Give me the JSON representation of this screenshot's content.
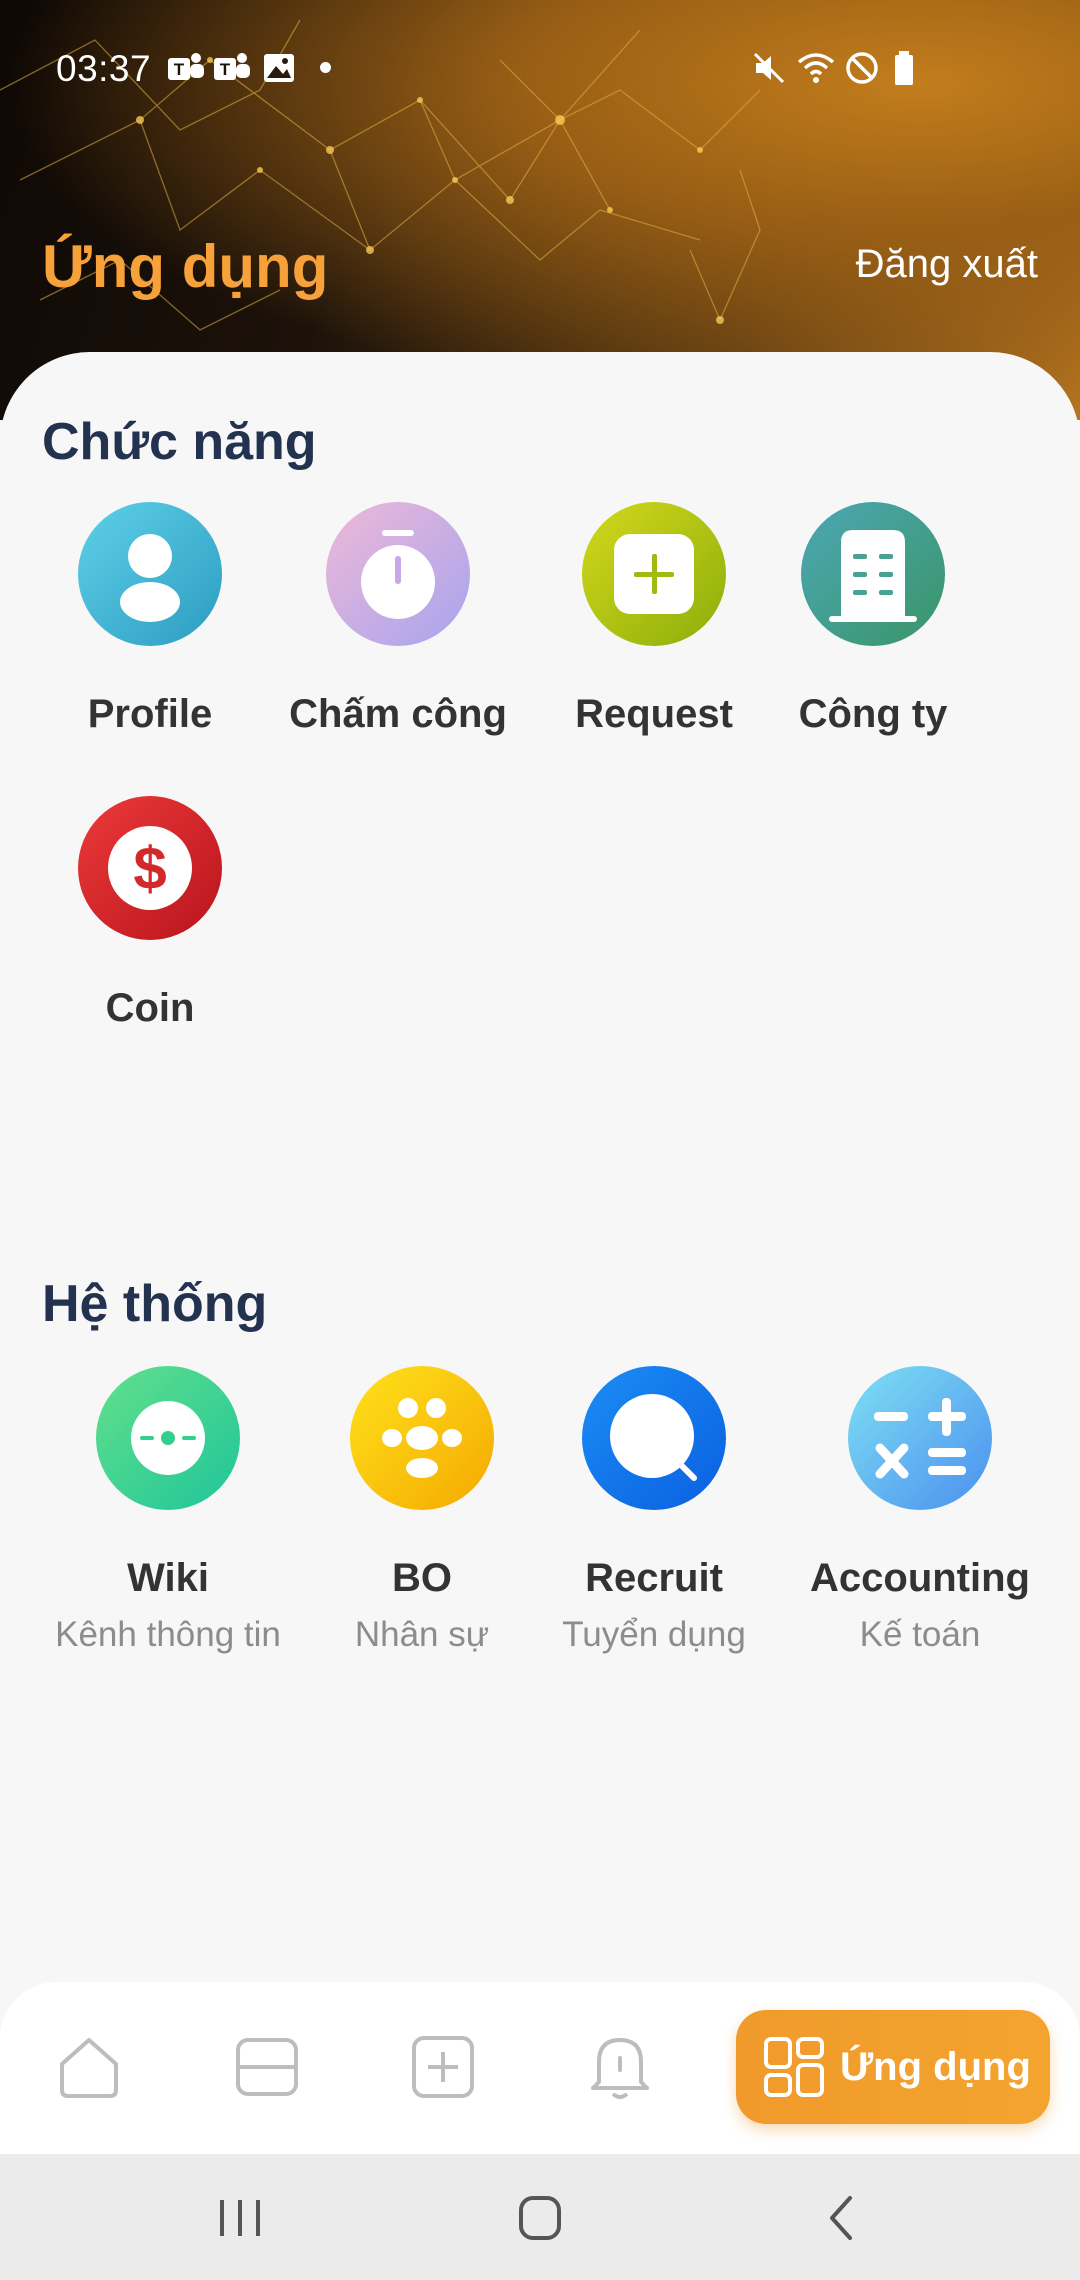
{
  "status_bar": {
    "time": "03:37",
    "left_icons": [
      "teams-icon",
      "teams-icon",
      "image-icon"
    ],
    "right_icons": [
      "mute-icon",
      "wifi-icon",
      "do-not-disturb-icon",
      "battery-icon"
    ]
  },
  "header": {
    "title": "Ứng dụng",
    "logout_label": "Đăng xuất"
  },
  "sections": {
    "features": {
      "title": "Chức năng",
      "items": [
        {
          "label": "Profile",
          "icon": "person-icon",
          "color": "#3fb3d6"
        },
        {
          "label": "Chấm công",
          "icon": "stopwatch-icon",
          "color": "#c9a6e8"
        },
        {
          "label": "Request",
          "icon": "plus-square-icon",
          "color": "#a8bd12"
        },
        {
          "label": "Công ty",
          "icon": "building-icon",
          "color": "#3f9f8c"
        },
        {
          "label": "Coin",
          "icon": "dollar-icon",
          "color": "#d82828"
        }
      ]
    },
    "system": {
      "title": "Hệ thống",
      "items": [
        {
          "label": "Wiki",
          "sublabel": "Kênh thông tin",
          "icon": "wiki-icon",
          "color": "#36d38a"
        },
        {
          "label": "BO",
          "sublabel": "Nhân sự",
          "icon": "people-icon",
          "color": "#f7c500"
        },
        {
          "label": "Recruit",
          "sublabel": "Tuyển dụng",
          "icon": "magnifier-icon",
          "color": "#1478ef"
        },
        {
          "label": "Accounting",
          "sublabel": "Kế toán",
          "icon": "calculator-icon",
          "color": "#5aa9f0"
        }
      ]
    }
  },
  "bottom_nav": {
    "items": [
      "home-icon",
      "card-icon",
      "add-icon",
      "bell-icon"
    ],
    "active_label": "Ứng dụng",
    "active_icon": "grid-icon",
    "accent": "#f09a2c"
  }
}
